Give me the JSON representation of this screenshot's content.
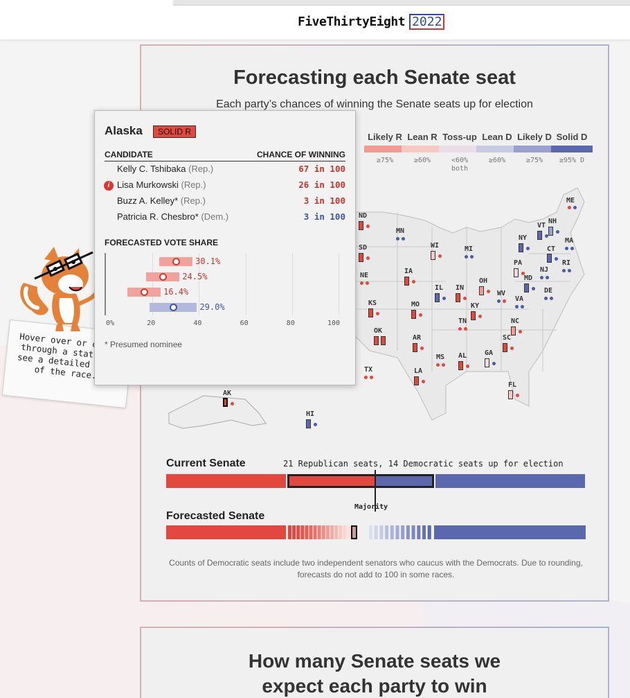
{
  "header": {
    "logo_name": "FiveThirtyEight",
    "logo_year": "2022"
  },
  "main": {
    "title": "Forecasting each Senate seat",
    "subtitle": "Each party’s chances of winning the Senate seats up for election"
  },
  "legend": [
    {
      "label": "Likely R",
      "pct": "≥75%",
      "color": "#f39a92"
    },
    {
      "label": "Lean R",
      "pct": "≥60%",
      "color": "#f8c9c3"
    },
    {
      "label": "Toss-up",
      "pct": "<60% both",
      "color": "#ebdde6"
    },
    {
      "label": "Lean D",
      "pct": "≥60%",
      "color": "#c7cbe3"
    },
    {
      "label": "Likely D",
      "pct": "≥75%",
      "color": "#9aa0d0"
    },
    {
      "label": "Solid D",
      "pct": "≥95% D",
      "color": "#5b68ad"
    }
  ],
  "colors": {
    "solid_r": "#e3483f",
    "likely_r": "#f39a92",
    "lean_r": "#f8c9c3",
    "tossup": "#ebdde6",
    "lean_d": "#c7cbe3",
    "likely_d": "#9aa0d0",
    "solid_d": "#5b68ad",
    "dot_r": "#e3483f",
    "dot_d": "#4a5ca8"
  },
  "states": [
    {
      "abbr": "ME"
    },
    {
      "abbr": "VT"
    },
    {
      "abbr": "NH"
    },
    {
      "abbr": "MA"
    },
    {
      "abbr": "NY"
    },
    {
      "abbr": "CT"
    },
    {
      "abbr": "RI"
    },
    {
      "abbr": "PA"
    },
    {
      "abbr": "NJ"
    },
    {
      "abbr": "MD"
    },
    {
      "abbr": "DE"
    },
    {
      "abbr": "ND"
    },
    {
      "abbr": "MN"
    },
    {
      "abbr": "WI"
    },
    {
      "abbr": "MI"
    },
    {
      "abbr": "SD"
    },
    {
      "abbr": "IA"
    },
    {
      "abbr": "NE"
    },
    {
      "abbr": "IL"
    },
    {
      "abbr": "IN"
    },
    {
      "abbr": "OH"
    },
    {
      "abbr": "WV"
    },
    {
      "abbr": "VA"
    },
    {
      "abbr": "KS"
    },
    {
      "abbr": "MO"
    },
    {
      "abbr": "KY"
    },
    {
      "abbr": "OK"
    },
    {
      "abbr": "TN"
    },
    {
      "abbr": "NC"
    },
    {
      "abbr": "AR"
    },
    {
      "abbr": "SC"
    },
    {
      "abbr": "MS"
    },
    {
      "abbr": "AL"
    },
    {
      "abbr": "GA"
    },
    {
      "abbr": "TX"
    },
    {
      "abbr": "LA"
    },
    {
      "abbr": "FL"
    },
    {
      "abbr": "AK"
    },
    {
      "abbr": "HI"
    }
  ],
  "current_senate": {
    "label": "Current Senate",
    "note": "21 Republican seats, 14 Democratic seats up for election"
  },
  "forecasted_senate": {
    "label": "Forecasted Senate",
    "majority": "Majority"
  },
  "footnote": "Counts of Democratic seats include two independent senators who caucus with the Democrats. Due to rounding, forecasts do not add to 100 in some races.",
  "next_section": {
    "title_line1": "How many Senate seats we",
    "title_line2": "expect each party to win"
  },
  "hint": {
    "text": "Hover over or click through a state to see a detailed view of the race."
  },
  "tooltip": {
    "state": "Alaska",
    "rating": "SOLID R",
    "col_candidate": "CANDIDATE",
    "col_chance": "CHANCE OF WINNING",
    "candidates": [
      {
        "name": "Kelly C. Tshibaka",
        "party": "(Rep.)",
        "chance": "67 in 100",
        "side": "R",
        "vote": 30.1
      },
      {
        "name": "Lisa Murkowski",
        "party": "(Rep.)",
        "chance": "26 in 100",
        "side": "R",
        "vote": 24.5,
        "info": "i"
      },
      {
        "name": "Buzz A. Kelley*",
        "party": "(Rep.)",
        "chance": "3 in 100",
        "side": "R",
        "vote": 16.4
      },
      {
        "name": "Patricia R. Chesbro*",
        "party": "(Dem.)",
        "chance": "3 in 100",
        "side": "D",
        "vote": 29.0
      }
    ],
    "vote_labels": [
      "30.1%",
      "24.5%",
      "16.4%",
      "29.0%"
    ],
    "vote_share_title": "FORECASTED VOTE SHARE",
    "ticks": [
      "0%",
      "20",
      "40",
      "60",
      "80",
      "100"
    ],
    "footnote": "* Presumed nominee"
  }
}
